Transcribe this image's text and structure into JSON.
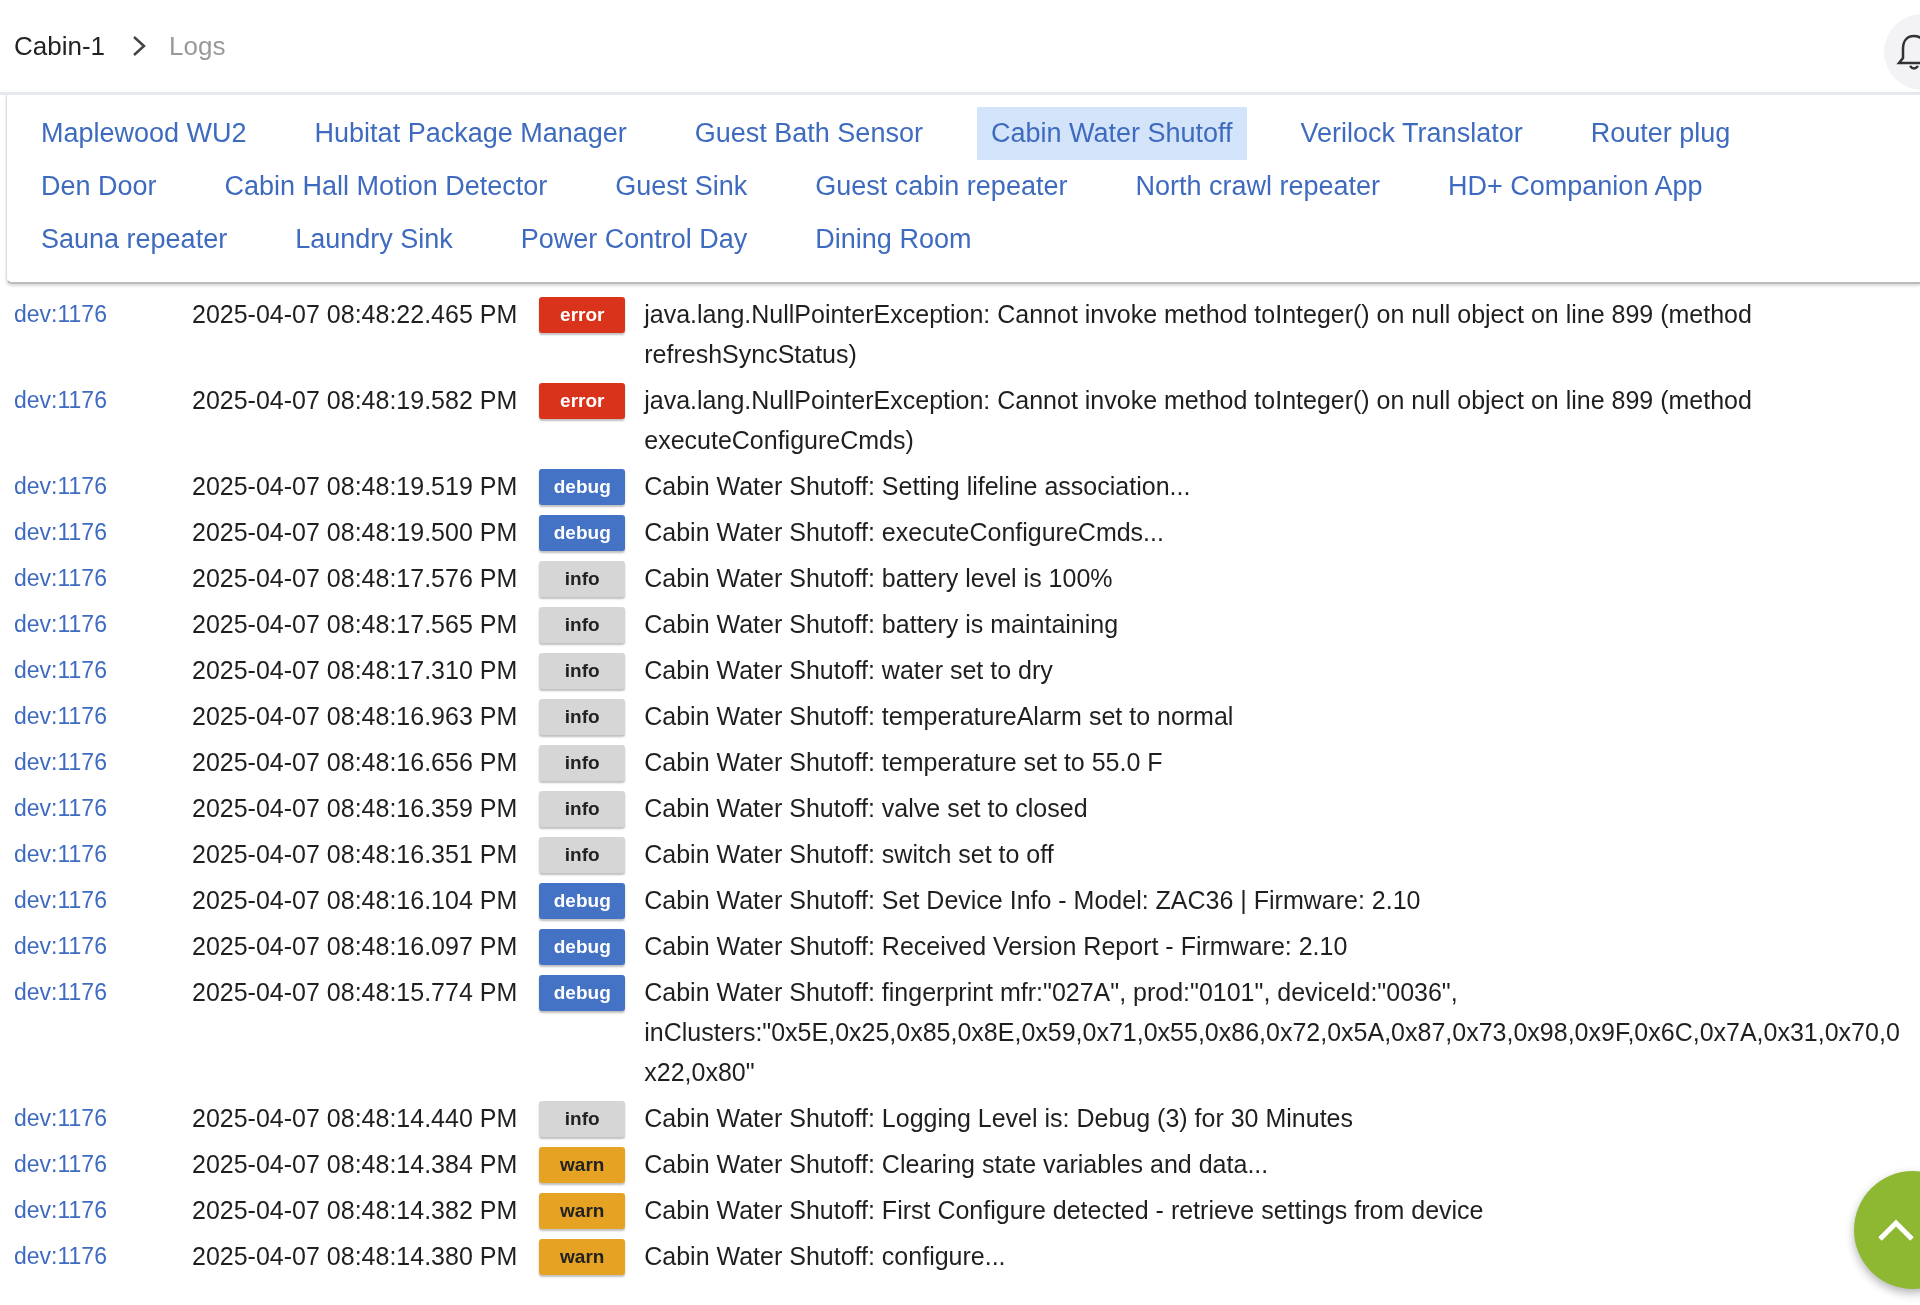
{
  "breadcrumb": {
    "parent": "Cabin-1",
    "current": "Logs"
  },
  "device_tabs": [
    {
      "label": "Maplewood WU2",
      "selected": false
    },
    {
      "label": "Hubitat Package Manager",
      "selected": false
    },
    {
      "label": "Guest Bath Sensor",
      "selected": false
    },
    {
      "label": "Cabin Water Shutoff",
      "selected": true
    },
    {
      "label": "Verilock Translator",
      "selected": false
    },
    {
      "label": "Router plug",
      "selected": false
    },
    {
      "label": "Den Door",
      "selected": false
    },
    {
      "label": "Cabin Hall Motion Detector",
      "selected": false
    },
    {
      "label": "Guest Sink",
      "selected": false
    },
    {
      "label": "Guest cabin repeater",
      "selected": false
    },
    {
      "label": "North crawl repeater",
      "selected": false
    },
    {
      "label": "HD+ Companion App",
      "selected": false
    },
    {
      "label": "Sauna repeater",
      "selected": false
    },
    {
      "label": "Laundry Sink",
      "selected": false
    },
    {
      "label": "Power Control Day",
      "selected": false
    },
    {
      "label": "Dining Room",
      "selected": false
    }
  ],
  "log_rows": [
    {
      "source": "dev:1176",
      "time": "2025-04-07 08:48:22.465 PM",
      "kind": "error",
      "label": "error",
      "message": "java.lang.NullPointerException: Cannot invoke method toInteger() on null object on line 899 (method refreshSyncStatus)"
    },
    {
      "source": "dev:1176",
      "time": "2025-04-07 08:48:19.582 PM",
      "kind": "error",
      "label": "error",
      "message": "java.lang.NullPointerException: Cannot invoke method toInteger() on null object on line 899 (method executeConfigureCmds)"
    },
    {
      "source": "dev:1176",
      "time": "2025-04-07 08:48:19.519 PM",
      "kind": "debug",
      "label": "debug",
      "message": "Cabin Water Shutoff: Setting lifeline association..."
    },
    {
      "source": "dev:1176",
      "time": "2025-04-07 08:48:19.500 PM",
      "kind": "debug",
      "label": "debug",
      "message": "Cabin Water Shutoff: executeConfigureCmds..."
    },
    {
      "source": "dev:1176",
      "time": "2025-04-07 08:48:17.576 PM",
      "kind": "info",
      "label": "info",
      "message": "Cabin Water Shutoff: battery level is 100%"
    },
    {
      "source": "dev:1176",
      "time": "2025-04-07 08:48:17.565 PM",
      "kind": "info",
      "label": "info",
      "message": "Cabin Water Shutoff: battery is maintaining"
    },
    {
      "source": "dev:1176",
      "time": "2025-04-07 08:48:17.310 PM",
      "kind": "info",
      "label": "info",
      "message": "Cabin Water Shutoff: water set to dry"
    },
    {
      "source": "dev:1176",
      "time": "2025-04-07 08:48:16.963 PM",
      "kind": "info",
      "label": "info",
      "message": "Cabin Water Shutoff: temperatureAlarm set to normal"
    },
    {
      "source": "dev:1176",
      "time": "2025-04-07 08:48:16.656 PM",
      "kind": "info",
      "label": "info",
      "message": "Cabin Water Shutoff: temperature set to 55.0 F"
    },
    {
      "source": "dev:1176",
      "time": "2025-04-07 08:48:16.359 PM",
      "kind": "info",
      "label": "info",
      "message": "Cabin Water Shutoff: valve set to closed"
    },
    {
      "source": "dev:1176",
      "time": "2025-04-07 08:48:16.351 PM",
      "kind": "info",
      "label": "info",
      "message": "Cabin Water Shutoff: switch set to off"
    },
    {
      "source": "dev:1176",
      "time": "2025-04-07 08:48:16.104 PM",
      "kind": "debug",
      "label": "debug",
      "message": "Cabin Water Shutoff: Set Device Info - Model: ZAC36 | Firmware: 2.10"
    },
    {
      "source": "dev:1176",
      "time": "2025-04-07 08:48:16.097 PM",
      "kind": "debug",
      "label": "debug",
      "message": "Cabin Water Shutoff: Received Version Report - Firmware: 2.10"
    },
    {
      "source": "dev:1176",
      "time": "2025-04-07 08:48:15.774 PM",
      "kind": "debug",
      "label": "debug",
      "message": "Cabin Water Shutoff: fingerprint mfr:\"027A\", prod:\"0101\", deviceId:\"0036\", inClusters:\"0x5E,0x25,0x85,0x8E,0x59,0x71,0x55,0x86,0x72,0x5A,0x87,0x73,0x98,0x9F,0x6C,0x7A,0x31,0x70,0x22,0x80\""
    },
    {
      "source": "dev:1176",
      "time": "2025-04-07 08:48:14.440 PM",
      "kind": "info",
      "label": "info",
      "message": "Cabin Water Shutoff: Logging Level is: Debug (3) for 30 Minutes"
    },
    {
      "source": "dev:1176",
      "time": "2025-04-07 08:48:14.384 PM",
      "kind": "warn",
      "label": "warn",
      "message": "Cabin Water Shutoff: Clearing state variables and data..."
    },
    {
      "source": "dev:1176",
      "time": "2025-04-07 08:48:14.382 PM",
      "kind": "warn",
      "label": "warn",
      "message": "Cabin Water Shutoff: First Configure detected - retrieve settings from device"
    },
    {
      "source": "dev:1176",
      "time": "2025-04-07 08:48:14.380 PM",
      "kind": "warn",
      "label": "warn",
      "message": "Cabin Water Shutoff: configure..."
    }
  ]
}
